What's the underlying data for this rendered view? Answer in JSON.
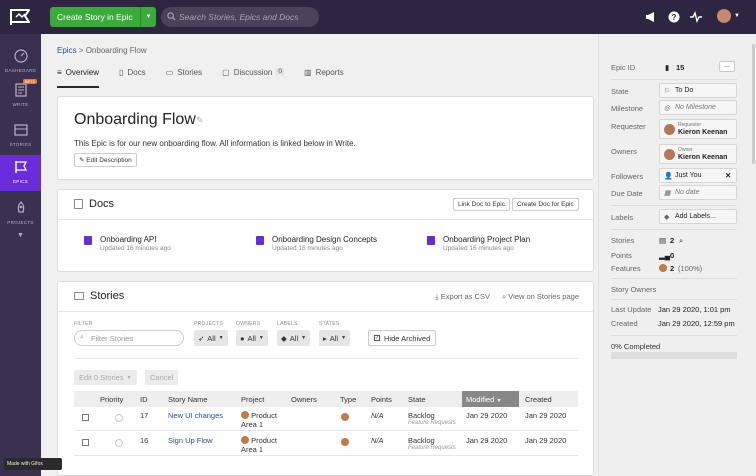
{
  "topbar": {
    "create_label": "Create Story in Epic",
    "search_placeholder": "Search Stories, Epics and Docs"
  },
  "nav": {
    "items": [
      {
        "label": "DASHBOARD"
      },
      {
        "label": "WRITE",
        "badge": "BETA"
      },
      {
        "label": "STORIES"
      },
      {
        "label": "EPICS"
      },
      {
        "label": "PROJECTS"
      }
    ]
  },
  "gifox": "Made with Gifox",
  "breadcrumb": {
    "root": "Epics",
    "sep": ">",
    "current": "Onboarding Flow"
  },
  "tabs": [
    {
      "label": "Overview"
    },
    {
      "label": "Docs"
    },
    {
      "label": "Stories"
    },
    {
      "label": "Discussion",
      "count": "0"
    },
    {
      "label": "Reports"
    }
  ],
  "epic": {
    "title": "Onboarding Flow",
    "description": "This Epic is for our new onboarding flow. All information is linked below in Write.",
    "edit_label": "Edit Description"
  },
  "docs": {
    "heading": "Docs",
    "link_btn": "Link Doc to Epic",
    "create_btn": "Create Doc for Epic",
    "items": [
      {
        "title": "Onboarding API",
        "updated": "Updated 16 minutes ago"
      },
      {
        "title": "Onboarding Design Concepts",
        "updated": "Updated 16 minutes ago"
      },
      {
        "title": "Onboarding Project Plan",
        "updated": "Updated 16 minutes ago"
      }
    ]
  },
  "stories": {
    "heading": "Stories",
    "export": "Export as CSV",
    "view_page": "View on Stories page",
    "filter_label": "FILTER",
    "filter_placeholder": "Filter Stories",
    "projects_label": "PROJECTS",
    "owners_label": "OWNERS",
    "labels_label": "LABELS",
    "states_label": "STATES",
    "all": "All",
    "hide_archived": "Hide Archived",
    "edit_btn": "Edit 0 Stories",
    "cancel_btn": "Cancel",
    "columns": [
      "Priority",
      "ID",
      "Story Name",
      "Project",
      "Owners",
      "Type",
      "Points",
      "State",
      "Modified",
      "Created"
    ],
    "rows": [
      {
        "id": "17",
        "name": "New UI changes",
        "project": "Product Area 1",
        "points": "N/A",
        "state": "Backlog",
        "workflow": "Feature Requests",
        "modified": "Jan 29 2020",
        "created": "Jan 29 2020"
      },
      {
        "id": "16",
        "name": "Sign Up Flow",
        "project": "Product Area 1",
        "points": "N/A",
        "state": "Backlog",
        "workflow": "Feature Requests",
        "modified": "Jan 29 2020",
        "created": "Jan 29 2020"
      }
    ]
  },
  "panel": {
    "epic_id_label": "Epic ID",
    "epic_id": "15",
    "more_btn": "...",
    "state_label": "State",
    "state": "To Do",
    "milestone_label": "Milestone",
    "milestone": "No Milestone",
    "requester_label": "Requester",
    "requester_role": "Requester",
    "requester": "Kieron Keenan",
    "owners_label": "Owners",
    "owner_role": "Owner",
    "owner": "Kieron Keenan",
    "followers_label": "Followers",
    "followers": "Just You",
    "due_label": "Due Date",
    "due": "No date",
    "labels_label": "Labels",
    "labels_btn": "Add Labels...",
    "stories_label": "Stories",
    "stories_count": "2",
    "points_label": "Points",
    "points": "0",
    "features_label": "Features",
    "features": "2",
    "features_pct": "(100%)",
    "story_owners_label": "Story Owners",
    "last_update_label": "Last Update",
    "last_update": "Jan 29 2020, 1:01 pm",
    "created_label": "Created",
    "created": "Jan 29 2020, 12:59 pm",
    "completed": "0% Completed",
    "completed_fraction": 0
  }
}
